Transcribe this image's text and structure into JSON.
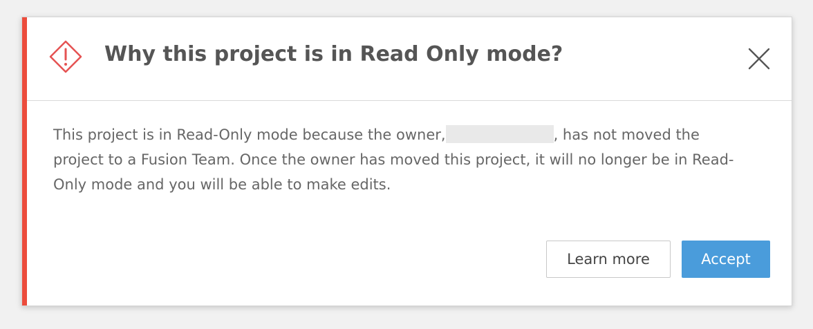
{
  "colors": {
    "accent": "#ec4c3c",
    "primary_button": "#4a9cdb",
    "warning_icon": "#e55353"
  },
  "dialog": {
    "title": "Why this project is in Read Only mode?",
    "warning_icon": "diamond-exclamation-icon",
    "close_icon": "close-icon",
    "message_part1": "This project is in Read-Only mode because the owner,",
    "message_part2": ", has not moved the project to a Fusion Team. Once the owner has moved this project, it will no longer be in Read-Only mode and you will be able to make edits.",
    "buttons": {
      "learn_more": "Learn more",
      "accept": "Accept"
    }
  }
}
